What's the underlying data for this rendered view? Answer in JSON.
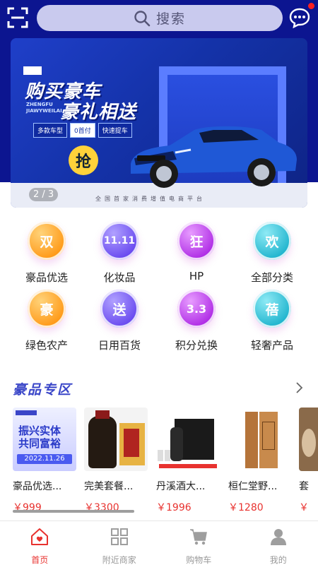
{
  "header": {
    "search_placeholder": "搜索",
    "icons": [
      "scan-icon",
      "search-icon",
      "message-icon"
    ],
    "has_notification_dot": true
  },
  "banner": {
    "title_line1": "购买豪车",
    "title_line2": "豪礼相送",
    "english_text": "ZHENGFU JIAWYWEILAI",
    "tags": [
      "多款车型",
      "0首付",
      "快速提车"
    ],
    "grab_label": "抢",
    "slogan": "全国首家消费增值电商平台",
    "pager": "2 / 3"
  },
  "categories": [
    {
      "label": "豪品优选",
      "glyph": "双",
      "color": "orange"
    },
    {
      "label": "化妆品",
      "glyph": "11.11",
      "color": "purple"
    },
    {
      "label": "HP",
      "glyph": "狂",
      "color": "magenta"
    },
    {
      "label": "全部分类",
      "glyph": "欢",
      "color": "cyan"
    },
    {
      "label": "绿色农产",
      "glyph": "豪",
      "color": "orange"
    },
    {
      "label": "日用百货",
      "glyph": "送",
      "color": "purple"
    },
    {
      "label": "积分兑换",
      "glyph": "3.3",
      "color": "magenta"
    },
    {
      "label": "轻奢产品",
      "glyph": "蓓",
      "color": "cyan"
    }
  ],
  "section": {
    "title": "豪品专区"
  },
  "products": [
    {
      "name": "豪品优选...",
      "price": "￥999",
      "img_text1": "振兴实体",
      "img_text2": "共同富裕",
      "img_date": "2022.11.26"
    },
    {
      "name": "完美套餐...",
      "price": "￥3300"
    },
    {
      "name": "丹溪酒大...",
      "price": "￥1996"
    },
    {
      "name": "桓仁堂野...",
      "price": "￥1280"
    },
    {
      "name": "套",
      "price": "￥"
    }
  ],
  "bottom_nav": [
    {
      "label": "首页",
      "icon": "home-icon",
      "active": true
    },
    {
      "label": "附近商家",
      "icon": "grid-icon",
      "active": false
    },
    {
      "label": "购物车",
      "icon": "cart-icon",
      "active": false
    },
    {
      "label": "我的",
      "icon": "user-icon",
      "active": false
    }
  ],
  "colors": {
    "header_bg": "#0c1590",
    "accent_red": "#e8322f",
    "section_title": "#3a46c8"
  }
}
